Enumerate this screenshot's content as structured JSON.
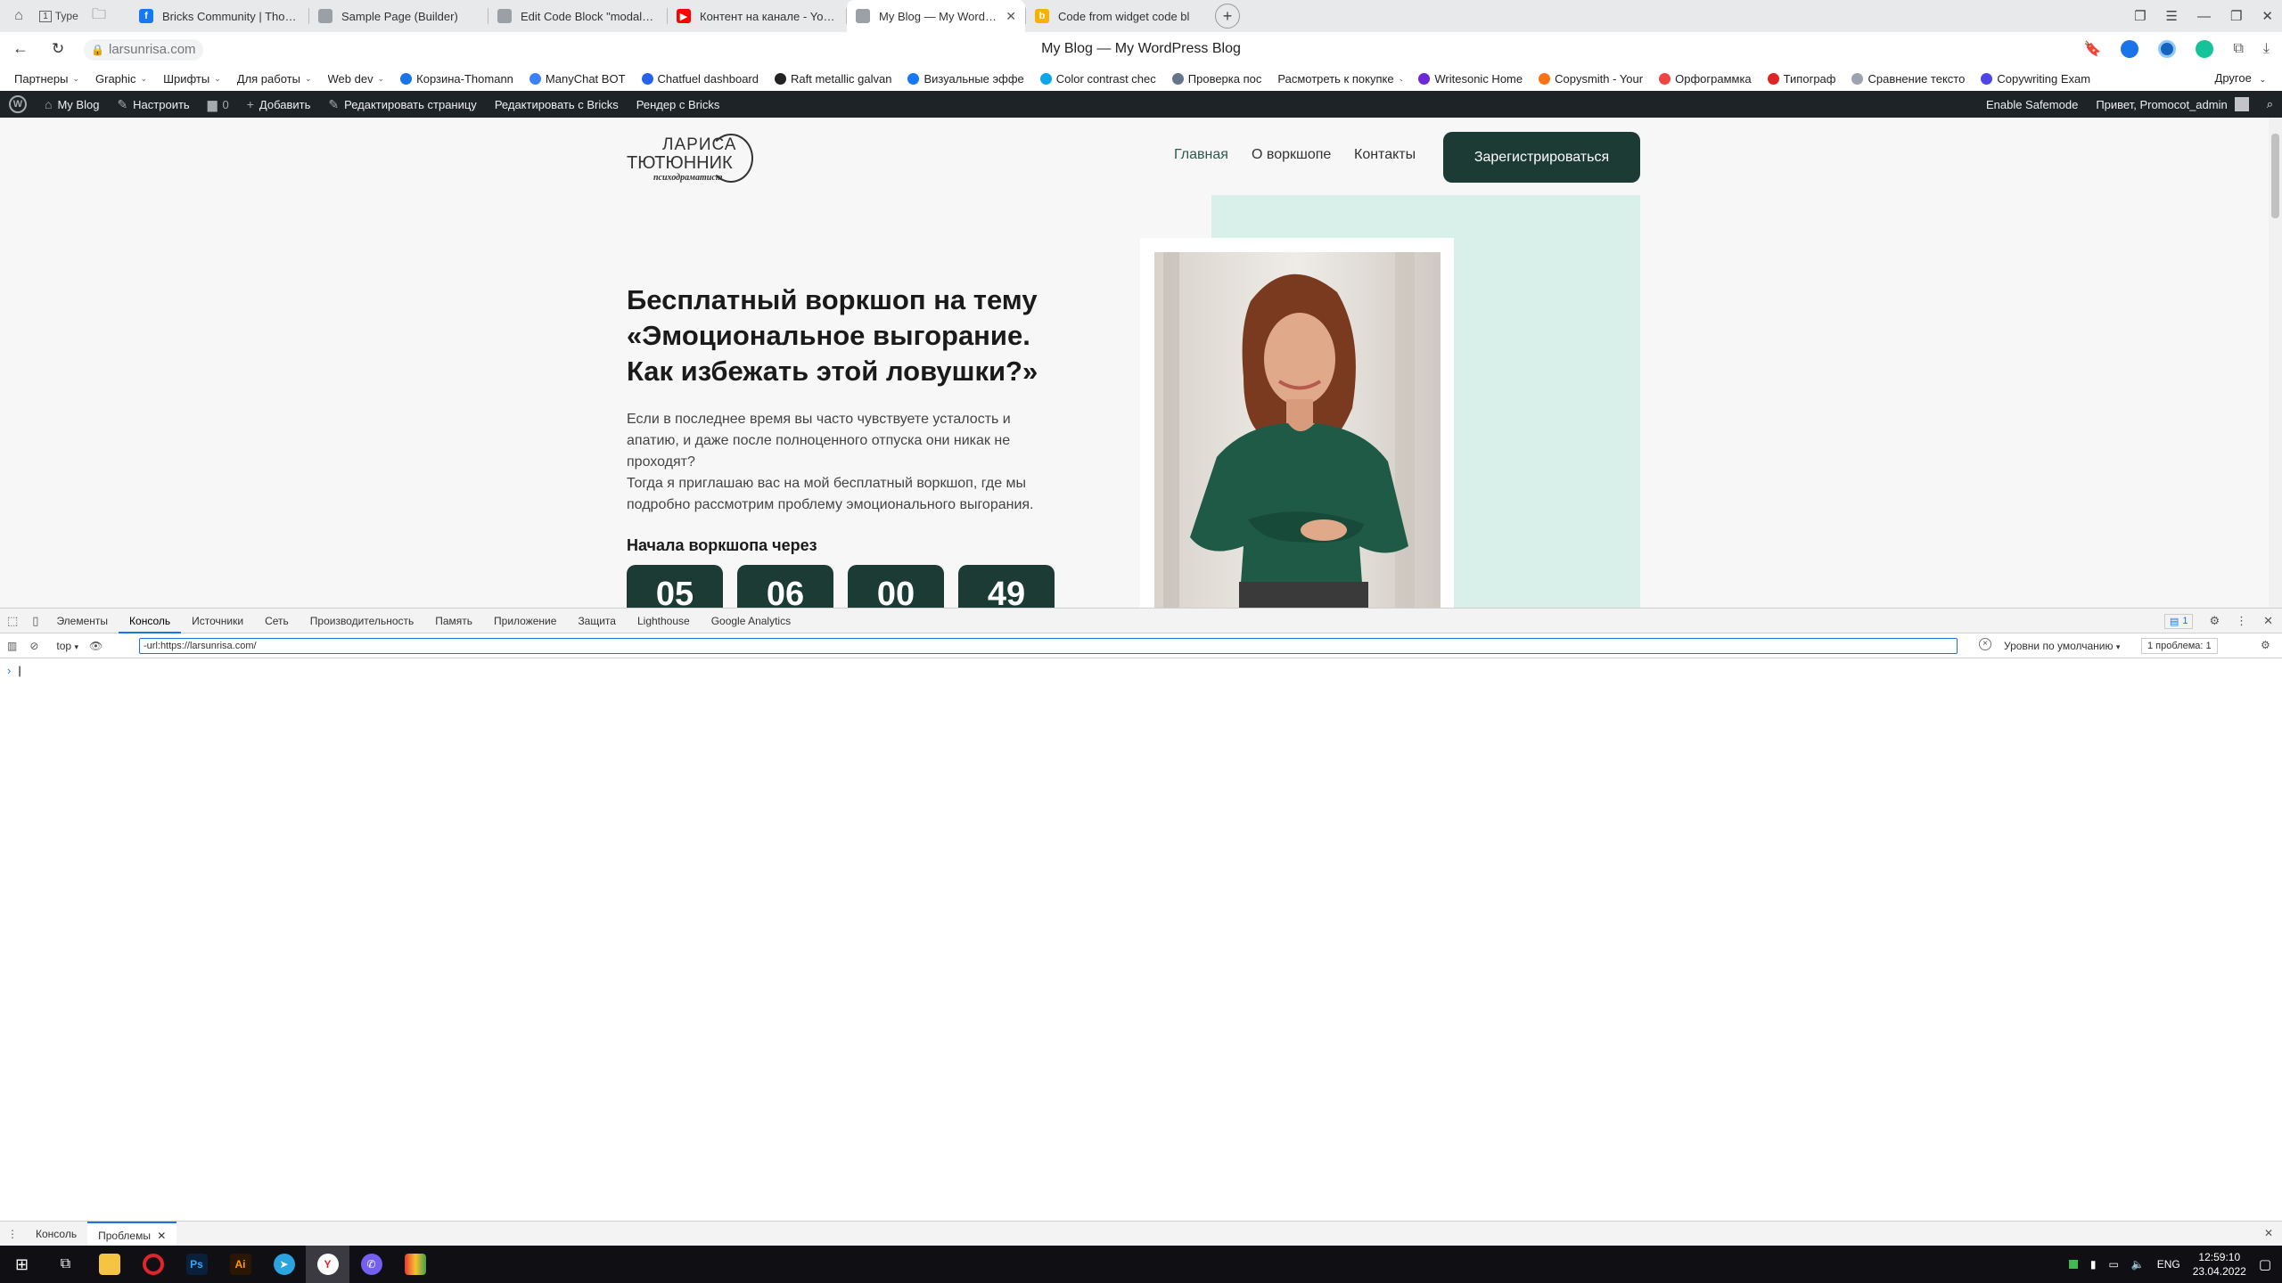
{
  "browser": {
    "tabs": [
      {
        "label": "Bricks Community | Thoma",
        "favicon_color": "#1877f2",
        "favicon_glyph": "f"
      },
      {
        "label": "Sample Page (Builder)",
        "favicon_color": "#9aa0a6",
        "favicon_glyph": ""
      },
      {
        "label": "Edit Code Block \"modaly\" -",
        "favicon_color": "#9aa0a6",
        "favicon_glyph": ""
      },
      {
        "label": "Контент на канале - YouTu",
        "favicon_color": "#ff0000",
        "favicon_glyph": "▶"
      },
      {
        "label": "My Blog — My WordPress",
        "favicon_color": "#9aa0a6",
        "favicon_glyph": ""
      },
      {
        "label": "Code from widget code bl",
        "favicon_color": "#f9b000",
        "favicon_glyph": "b"
      }
    ],
    "active_tab_index": 4,
    "nav_left": {
      "type_label": "Type",
      "tab_count": "1"
    },
    "url": "larsunrisa.com",
    "page_title": "My Blog — My WordPress Blog",
    "bookmarks": [
      {
        "label": "Партнеры",
        "dropdown": true,
        "color": ""
      },
      {
        "label": "Graphic",
        "dropdown": true,
        "color": ""
      },
      {
        "label": "Шрифты",
        "dropdown": true,
        "color": ""
      },
      {
        "label": "Для работы",
        "dropdown": true,
        "color": ""
      },
      {
        "label": "Web dev",
        "dropdown": true,
        "color": ""
      },
      {
        "label": "Корзина-Thomann",
        "dropdown": false,
        "color": "#1a73e8"
      },
      {
        "label": "ManyChat BOT",
        "dropdown": false,
        "color": "#3b82f6"
      },
      {
        "label": "Chatfuel dashboard",
        "dropdown": false,
        "color": "#2563eb"
      },
      {
        "label": "Raft metallic galvan",
        "dropdown": false,
        "color": "#222222"
      },
      {
        "label": "Визуальные эффе",
        "dropdown": false,
        "color": "#1877f2"
      },
      {
        "label": "Color contrast chec",
        "dropdown": false,
        "color": "#0ea5e9"
      },
      {
        "label": "Проверка пос",
        "dropdown": false,
        "color": "#64748b"
      },
      {
        "label": "Расмотреть к покупке",
        "dropdown": true,
        "color": ""
      },
      {
        "label": "Writesonic Home",
        "dropdown": false,
        "color": "#6d28d9"
      },
      {
        "label": "Copysmith - Your",
        "dropdown": false,
        "color": "#f97316"
      },
      {
        "label": "Орфограммка",
        "dropdown": false,
        "color": "#ef4444"
      },
      {
        "label": "Типограф",
        "dropdown": false,
        "color": "#dc2626"
      },
      {
        "label": "Сравнение тексто",
        "dropdown": false,
        "color": "#9ca3af"
      },
      {
        "label": "Copywriting Exam",
        "dropdown": false,
        "color": "#4f46e5"
      }
    ],
    "bookmarks_other": "Другое"
  },
  "wpbar": {
    "site": "My Blog",
    "customize": "Настроить",
    "comments_count": "0",
    "add_new": "Добавить",
    "edit_page": "Редактировать страницу",
    "edit_bricks": "Редактировать с Bricks",
    "render_bricks": "Рендер с Bricks",
    "safemode": "Enable Safemode",
    "greeting": "Привет, Promocot_admin"
  },
  "site": {
    "logo": {
      "line1": "ЛАРИСА",
      "line2": "ТЮТЮННИК",
      "line3": "психодраматист"
    },
    "nav": {
      "home": "Главная",
      "about": "О воркшопе",
      "contacts": "Контакты"
    },
    "cta": "Зарегистрироваться",
    "heading": [
      "Бесплатный воркшоп на тему",
      "«Эмоциональное выгорание.",
      "Как избежать этой ловушки?»"
    ],
    "description": [
      "Если в последнее время вы часто чувствуете усталость и",
      "апатию, и даже после полноценного отпуска они никак не",
      "проходят?",
      "Тогда я приглашаю вас на мой бесплатный воркшоп, где мы",
      "подробно рассмотрим проблему эмоционального выгорания."
    ],
    "countdown_label": "Начала воркшопа через",
    "countdown": [
      "05",
      "06",
      "00",
      "49"
    ],
    "colors": {
      "accent_dark": "#1b3b34",
      "mint": "#d9efe9",
      "nav_active": "#2b5a4d"
    }
  },
  "devtools": {
    "tabs": [
      "Элементы",
      "Консоль",
      "Источники",
      "Сеть",
      "Производительность",
      "Память",
      "Приложение",
      "Защита",
      "Lighthouse",
      "Google Analytics"
    ],
    "active_tab": "Консоль",
    "issues_badge": "1",
    "context": "top",
    "filter_value": "-url:https://larsunrisa.com/",
    "levels": "Уровни по умолчанию",
    "issues_count": "1 проблема: 1",
    "drawer_tabs": [
      "Консоль",
      "Проблемы"
    ],
    "drawer_active": "Проблемы"
  },
  "taskbar": {
    "time": "12:59:10",
    "date": "23.04.2022",
    "lang": "ENG"
  }
}
